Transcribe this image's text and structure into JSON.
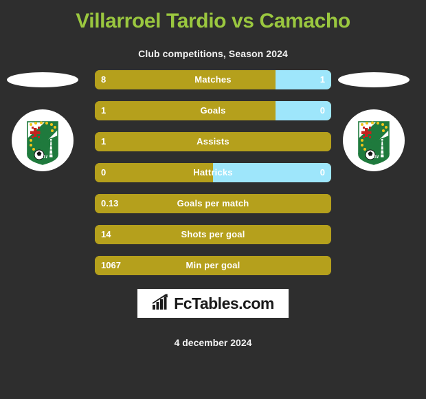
{
  "header": {
    "title": "Villarroel Tardio vs Camacho",
    "subtitle": "Club competitions, Season 2024"
  },
  "colors": {
    "background": "#2e2e2e",
    "title_green": "#9ac73f",
    "bar_gold": "#b5a01c",
    "bar_blue": "#9ee6fb",
    "text_white": "#ffffff",
    "crest_green": "#1f7a3d",
    "crest_red": "#c3231f",
    "crest_star_yellow": "#f0c419"
  },
  "badges": {
    "home": {
      "avatar": "player-avatar-placeholder",
      "crest_name": "club-crest"
    },
    "away": {
      "avatar": "player-avatar-placeholder",
      "crest_name": "club-crest"
    }
  },
  "chart_data": {
    "type": "bar",
    "title": "Villarroel Tardio vs Camacho",
    "subtitle": "Club competitions, Season 2024",
    "orientation": "horizontal-split",
    "legend_position": "none",
    "grid": false,
    "series": [
      {
        "name": "Villarroel Tardio",
        "color": "#b5a01c"
      },
      {
        "name": "Camacho",
        "color": "#9ee6fb"
      }
    ],
    "categories": [
      "Matches",
      "Goals",
      "Assists",
      "Hattricks",
      "Goals per match",
      "Shots per goal",
      "Min per goal"
    ],
    "rows": [
      {
        "label": "Matches",
        "left_value": "8",
        "right_value": "1",
        "left_pct": 76.5,
        "right_pct": 23.5,
        "has_right": true
      },
      {
        "label": "Goals",
        "left_value": "1",
        "right_value": "0",
        "left_pct": 76.5,
        "right_pct": 23.5,
        "has_right": true
      },
      {
        "label": "Assists",
        "left_value": "1",
        "right_value": "",
        "left_pct": 100,
        "right_pct": 0,
        "has_right": false
      },
      {
        "label": "Hattricks",
        "left_value": "0",
        "right_value": "0",
        "left_pct": 50,
        "right_pct": 50,
        "has_right": true
      },
      {
        "label": "Goals per match",
        "left_value": "0.13",
        "right_value": "",
        "left_pct": 100,
        "right_pct": 0,
        "has_right": false
      },
      {
        "label": "Shots per goal",
        "left_value": "14",
        "right_value": "",
        "left_pct": 100,
        "right_pct": 0,
        "has_right": false
      },
      {
        "label": "Min per goal",
        "left_value": "1067",
        "right_value": "",
        "left_pct": 100,
        "right_pct": 0,
        "has_right": false
      }
    ]
  },
  "footer": {
    "logo_text": "FcTables.com",
    "logo_icon": "bar-chart-icon",
    "date": "4 december 2024"
  }
}
